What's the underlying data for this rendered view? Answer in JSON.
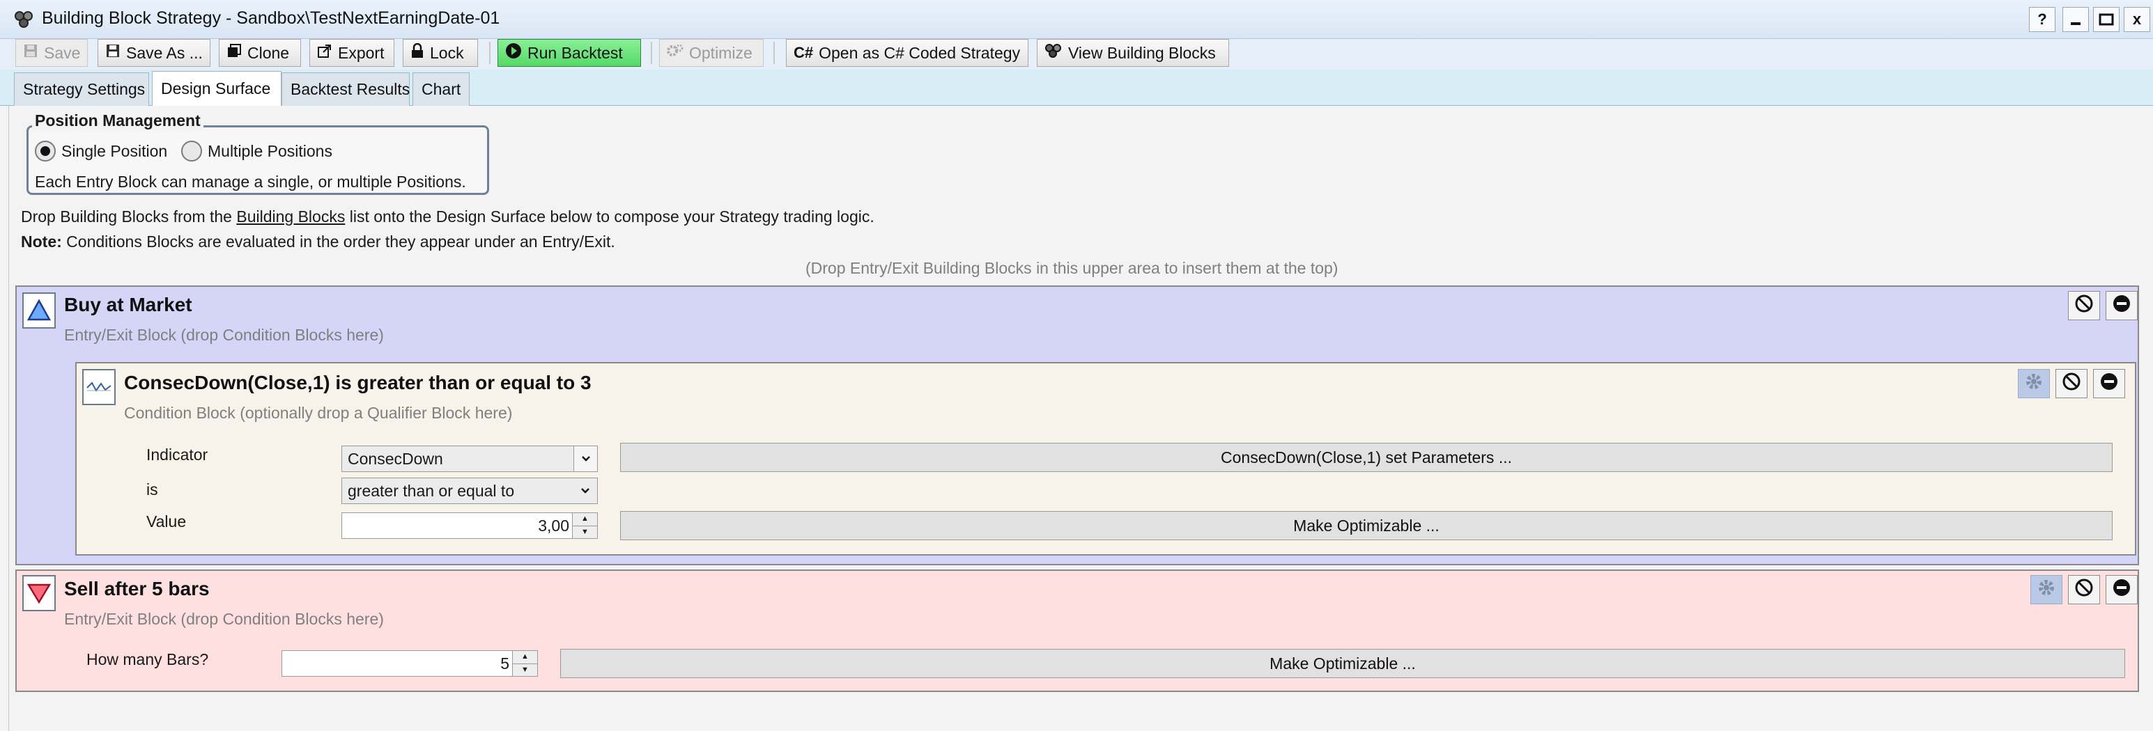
{
  "window": {
    "title": "Building Block Strategy - Sandbox\\TestNextEarningDate-01",
    "help_label": "?",
    "minimize_label": "—",
    "maximize_label": "▭",
    "close_label": "x"
  },
  "toolbar": {
    "save": "Save",
    "save_as": "Save As ...",
    "clone": "Clone",
    "export": "Export",
    "lock": "Lock",
    "run_backtest": "Run Backtest",
    "optimize": "Optimize",
    "open_csharp": "Open as C# Coded Strategy",
    "view_blocks": "View Building Blocks"
  },
  "tabs": [
    {
      "label": "Strategy Settings",
      "active": false
    },
    {
      "label": "Design Surface",
      "active": true
    },
    {
      "label": "Backtest Results",
      "active": false
    },
    {
      "label": "Chart",
      "active": false
    }
  ],
  "position_management": {
    "title": "Position Management",
    "single_label": "Single Position",
    "multiple_label": "Multiple Positions",
    "selected": "Single Position",
    "description": "Each Entry Block can manage a single, or multiple Positions."
  },
  "instructions": {
    "line1_prefix": "Drop Building Blocks from the",
    "line1_link": "Building Blocks",
    "line1_suffix": "list onto the Design Surface below to compose your Strategy trading logic.",
    "note_label": "Note:",
    "note_text": "Conditions Blocks are evaluated in the order they appear under an Entry/Exit.",
    "drop_hint": "(Drop Entry/Exit Building Blocks in this upper area to insert them at the top)"
  },
  "entry_block": {
    "title": "Buy at Market",
    "subtitle": "Entry/Exit Block (drop Condition Blocks here)",
    "condition": {
      "title": "ConsecDown(Close,1) is greater than or equal to 3",
      "subtitle": "Condition Block (optionally drop a Qualifier Block here)",
      "indicator_label": "Indicator",
      "indicator_value": "ConsecDown",
      "is_label": "is",
      "is_value": "greater than or equal to",
      "value_label": "Value",
      "value": "3,00",
      "params_button": "ConsecDown(Close,1) set Parameters ...",
      "optimizable_button": "Make Optimizable ..."
    }
  },
  "exit_block": {
    "title": "Sell after 5 bars",
    "subtitle": "Entry/Exit Block (drop Condition Blocks here)",
    "bars_label": "How many Bars?",
    "bars_value": "5",
    "optimizable_button": "Make Optimizable ..."
  }
}
